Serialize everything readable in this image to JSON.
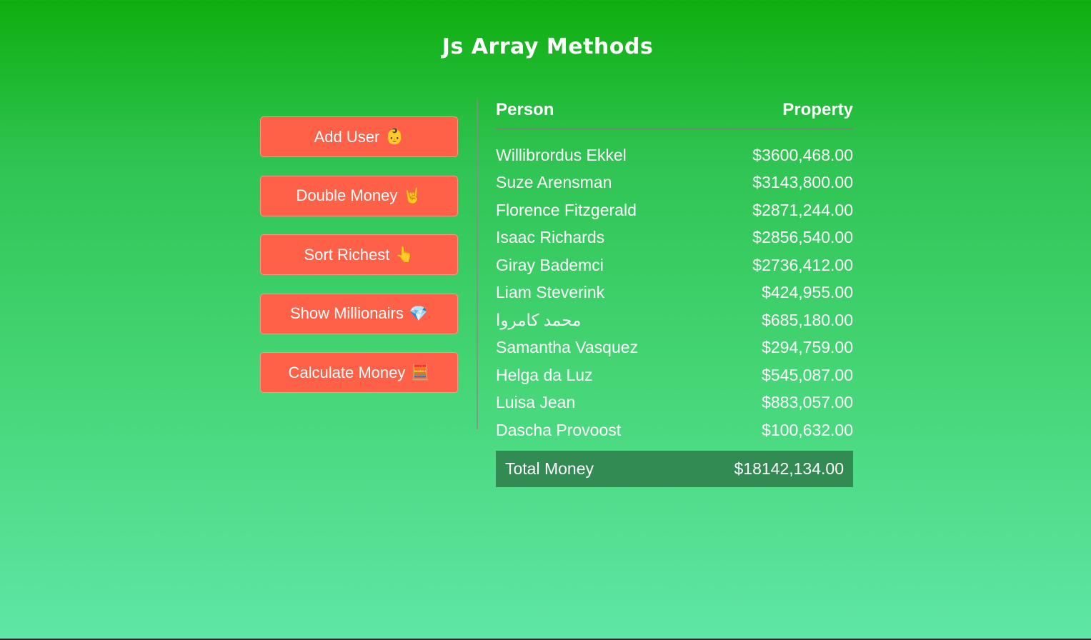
{
  "title": "Js Array Methods",
  "buttons": [
    {
      "label": "Add User",
      "emoji": "👶"
    },
    {
      "label": "Double Money",
      "emoji": "🤘"
    },
    {
      "label": "Sort Richest",
      "emoji": "👆"
    },
    {
      "label": "Show Millionairs",
      "emoji": "💎"
    },
    {
      "label": "Calculate Money",
      "emoji": "🧮"
    }
  ],
  "table": {
    "headers": {
      "person": "Person",
      "property": "Property"
    },
    "rows": [
      {
        "name": "Willibrordus Ekkel",
        "money": "$3600,468.00"
      },
      {
        "name": "Suze Arensman",
        "money": "$3143,800.00"
      },
      {
        "name": "Florence Fitzgerald",
        "money": "$2871,244.00"
      },
      {
        "name": "Isaac Richards",
        "money": "$2856,540.00"
      },
      {
        "name": "Giray Bademci",
        "money": "$2736,412.00"
      },
      {
        "name": "Liam Steverink",
        "money": "$424,955.00"
      },
      {
        "name": "محمد كامروا",
        "money": "$685,180.00"
      },
      {
        "name": "Samantha Vasquez",
        "money": "$294,759.00"
      },
      {
        "name": "Helga da Luz",
        "money": "$545,087.00"
      },
      {
        "name": "Luisa Jean",
        "money": "$883,057.00"
      },
      {
        "name": "Dascha Provoost",
        "money": "$100,632.00"
      }
    ],
    "total": {
      "label": "Total Money",
      "value": "$18142,134.00"
    }
  },
  "colors": {
    "button_bg": "#ff6148",
    "total_bg": "#318b53",
    "gradient_top": "#0fae0f",
    "gradient_bottom": "#5fe6a6"
  }
}
